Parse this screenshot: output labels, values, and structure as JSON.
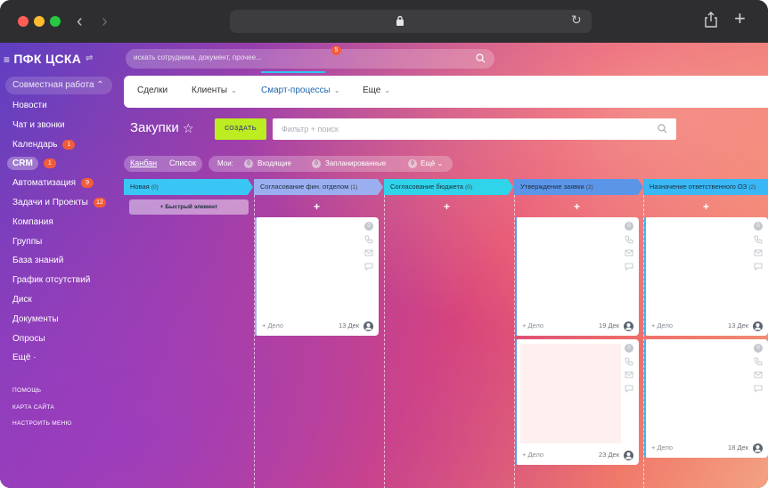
{
  "sidebar": {
    "logo": "ПФК ЦСКА",
    "group_toggle": "Совместная работа ⌃",
    "items": [
      {
        "label": "Новости"
      },
      {
        "label": "Чат и звонки"
      },
      {
        "label": "Календарь",
        "badge": "1"
      },
      {
        "label": "CRM",
        "badge": "1",
        "active": true
      },
      {
        "label": "Автоматизация",
        "badge": "9"
      },
      {
        "label": "Задачи и Проекты",
        "badge": "12"
      },
      {
        "label": "Компания"
      },
      {
        "label": "Группы"
      },
      {
        "label": "База знаний"
      },
      {
        "label": "График отсутствий"
      },
      {
        "label": "Диск"
      },
      {
        "label": "Документы"
      },
      {
        "label": "Опросы"
      },
      {
        "label": "Ещё ·"
      }
    ],
    "footer_links": [
      "ПОМОЩЬ",
      "КАРТА САЙТА",
      "НАСТРОИТЬ МЕНЮ"
    ]
  },
  "search": {
    "placeholder": "искать сотрудника, документ, прочее..."
  },
  "topnav": {
    "tabs": [
      {
        "label": "Сделки"
      },
      {
        "label": "Клиенты",
        "chevron": "⌄"
      },
      {
        "label": "Смарт-процессы",
        "chevron": "⌄",
        "active": true,
        "badge": "5"
      },
      {
        "label": "Еще",
        "chevron": "⌄"
      }
    ]
  },
  "page": {
    "title": "Закупки",
    "create_label": "СОЗДАТЬ",
    "filter_placeholder": "Фильтр + поиск"
  },
  "toolbar": {
    "kanban": "Канбан",
    "list": "Список",
    "mine": "Мои:",
    "incoming_count": "0",
    "incoming": "Входящие",
    "planned_count": "0",
    "planned": "Запланированные",
    "more_count": "0",
    "more": "Ещё ⌄"
  },
  "columns": [
    {
      "title": "Новая",
      "count": "(0)",
      "color": "#39c6f5",
      "quick_add": "+  Быстрый элемент"
    },
    {
      "title": "Согласование фин. отделом",
      "count": "(1)",
      "color": "#9aaef0",
      "plus": "+"
    },
    {
      "title": "Согласование бюджета",
      "count": "(0)",
      "color": "#2fd3ea",
      "plus": "+"
    },
    {
      "title": "Утверждение заявки",
      "count": "(2)",
      "color": "#5b95e8",
      "plus": "+"
    },
    {
      "title": "Назначение ответственного ОЗ",
      "count": "(2)",
      "color": "#39b8f5",
      "plus": "+"
    }
  ],
  "cards": [
    {
      "column": 1,
      "footer": "+ Дело",
      "date": "13 Дек",
      "zero": "0"
    },
    {
      "column": 3,
      "footer": "+ Дело",
      "date": "19 Дек",
      "zero": "0"
    },
    {
      "column": 3,
      "footer": "+ Дело",
      "date": "23 Дек",
      "zero": "0"
    },
    {
      "column": 4,
      "footer": "+ Дело",
      "date": "13 Дек",
      "zero": "0"
    },
    {
      "column": 4,
      "footer": "+ Дело",
      "date": "18 Дек",
      "zero": "0"
    }
  ],
  "colors": {
    "accent": "#2fc6f6",
    "create": "#bbed21",
    "badge": "#f25c3b"
  }
}
